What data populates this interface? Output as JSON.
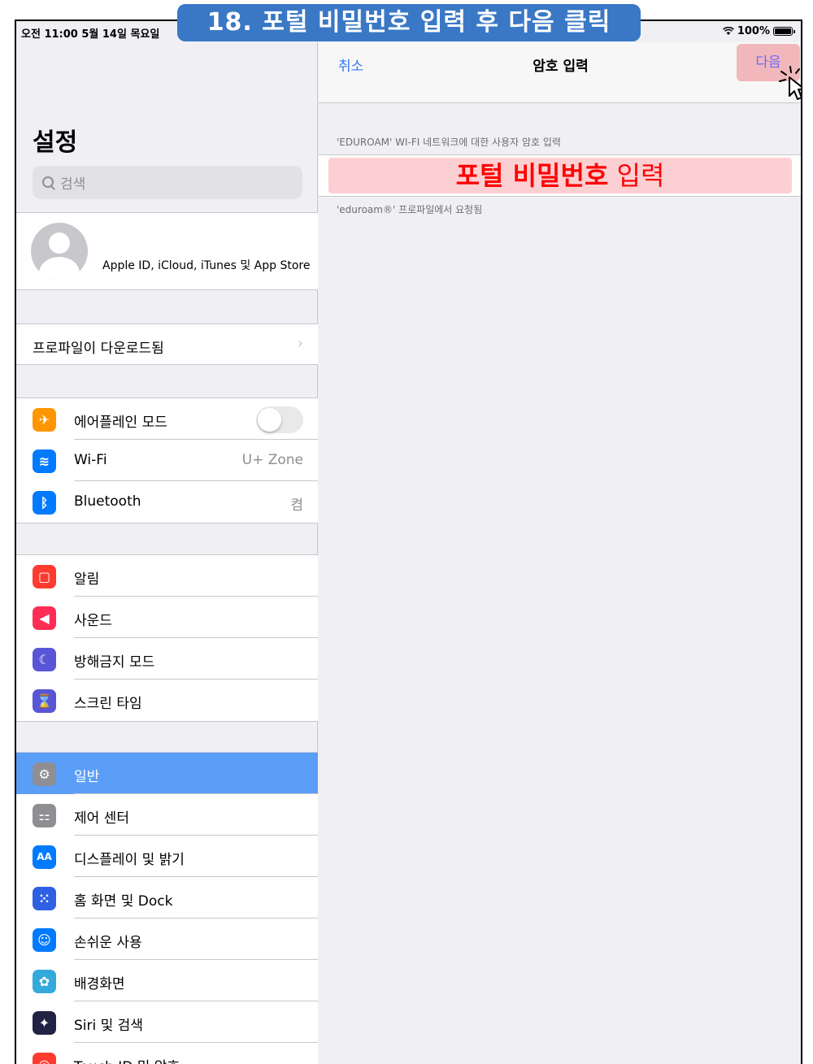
{
  "status_bar": {
    "time_date": "오전 11:00  5월 14일 목요일",
    "battery": "100%"
  },
  "overlay_title": "18. 포털 비밀번호 입력 후 다음 클릭",
  "sidebar": {
    "title": "설정",
    "search_placeholder": "검색",
    "apple_id_label": "Apple ID, iCloud, iTunes 및 App Store",
    "profile_label": "프로파일이 다운로드됨",
    "profile_chevron": "›",
    "connectivity": [
      {
        "label": "에어플레인 모드",
        "icon": "airplane-icon",
        "color": "#ff9500",
        "glyph": "✈",
        "value": ""
      },
      {
        "label": "Wi-Fi",
        "icon": "wifi-icon",
        "color": "#007aff",
        "glyph": "≋",
        "value": "U+ Zone"
      },
      {
        "label": "Bluetooth",
        "icon": "bluetooth-icon",
        "color": "#007aff",
        "glyph": "ᛒ",
        "value": "켬"
      }
    ],
    "notifications": [
      {
        "label": "알림",
        "icon": "notifications-icon",
        "color": "#ff3b30",
        "glyph": "▢"
      },
      {
        "label": "사운드",
        "icon": "sound-icon",
        "color": "#ff2d55",
        "glyph": "◀"
      },
      {
        "label": "방해금지 모드",
        "icon": "moon-icon",
        "color": "#5856d6",
        "glyph": "☾"
      },
      {
        "label": "스크린 타임",
        "icon": "hourglass-icon",
        "color": "#5856d6",
        "glyph": "⌛"
      }
    ],
    "general": [
      {
        "label": "일반",
        "icon": "gear-icon",
        "color": "#8e8e93",
        "glyph": "⚙",
        "selected": true
      },
      {
        "label": "제어 센터",
        "icon": "control-center-icon",
        "color": "#8e8e93",
        "glyph": "⚏"
      },
      {
        "label": "디스플레이 및 밝기",
        "icon": "display-icon",
        "color": "#007aff",
        "glyph": "AA"
      },
      {
        "label": "홈 화면 및 Dock",
        "icon": "home-screen-icon",
        "color": "#2f5fe3",
        "glyph": "⁙"
      },
      {
        "label": "손쉬운 사용",
        "icon": "accessibility-icon",
        "color": "#007aff",
        "glyph": "☺"
      },
      {
        "label": "배경화면",
        "icon": "wallpaper-icon",
        "color": "#34aadc",
        "glyph": "✿"
      },
      {
        "label": "Siri 및 검색",
        "icon": "siri-icon",
        "color": "#222244",
        "glyph": "✦"
      },
      {
        "label": "Touch ID 및 암호",
        "icon": "fingerprint-icon",
        "color": "#ff3b30",
        "glyph": "◎"
      }
    ]
  },
  "detail": {
    "cancel_label": "취소",
    "title": "암호 입력",
    "next_label": "다음",
    "section_header": "'EDUROAM' WI-FI 네트워크에 대한 사용자 암호 입력",
    "password_hint_bold": "포털 비밀번호",
    "password_hint_rest": " 입력",
    "section_footer": "'eduroam®' 프로파일에서 요청됨"
  },
  "colors": {
    "accent": "#3478f6",
    "selected_row": "#5b9ef8",
    "overlay_blue": "#3a78c6",
    "highlight_red": "#ff0000"
  }
}
